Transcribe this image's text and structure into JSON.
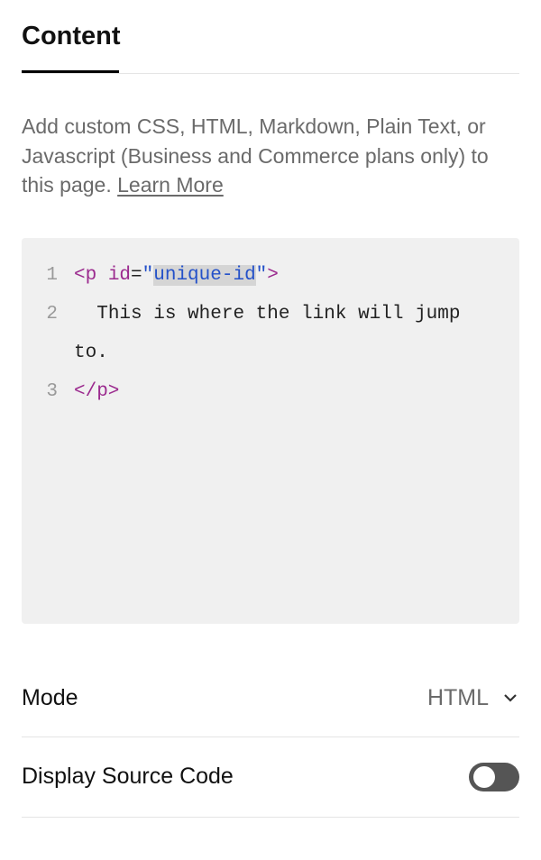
{
  "tab": {
    "title": "Content"
  },
  "description": {
    "text": "Add custom CSS, HTML, Markdown, Plain Text, or Javascript (Business and Commerce plans only) to this page. ",
    "link_text": "Learn More"
  },
  "code": {
    "lines": [
      {
        "num": "1",
        "open_tag": "<p",
        "attr_name": " id",
        "equals": "=",
        "quote1": "\"",
        "attr_value": "unique-id",
        "quote2": "\"",
        "close_bracket": ">"
      },
      {
        "num": "2",
        "text": "  This is where the link will jump to."
      },
      {
        "num": "3",
        "close_tag": "</p>"
      }
    ]
  },
  "settings": {
    "mode": {
      "label": "Mode",
      "value": "HTML"
    },
    "display_source": {
      "label": "Display Source Code",
      "enabled": false
    }
  }
}
